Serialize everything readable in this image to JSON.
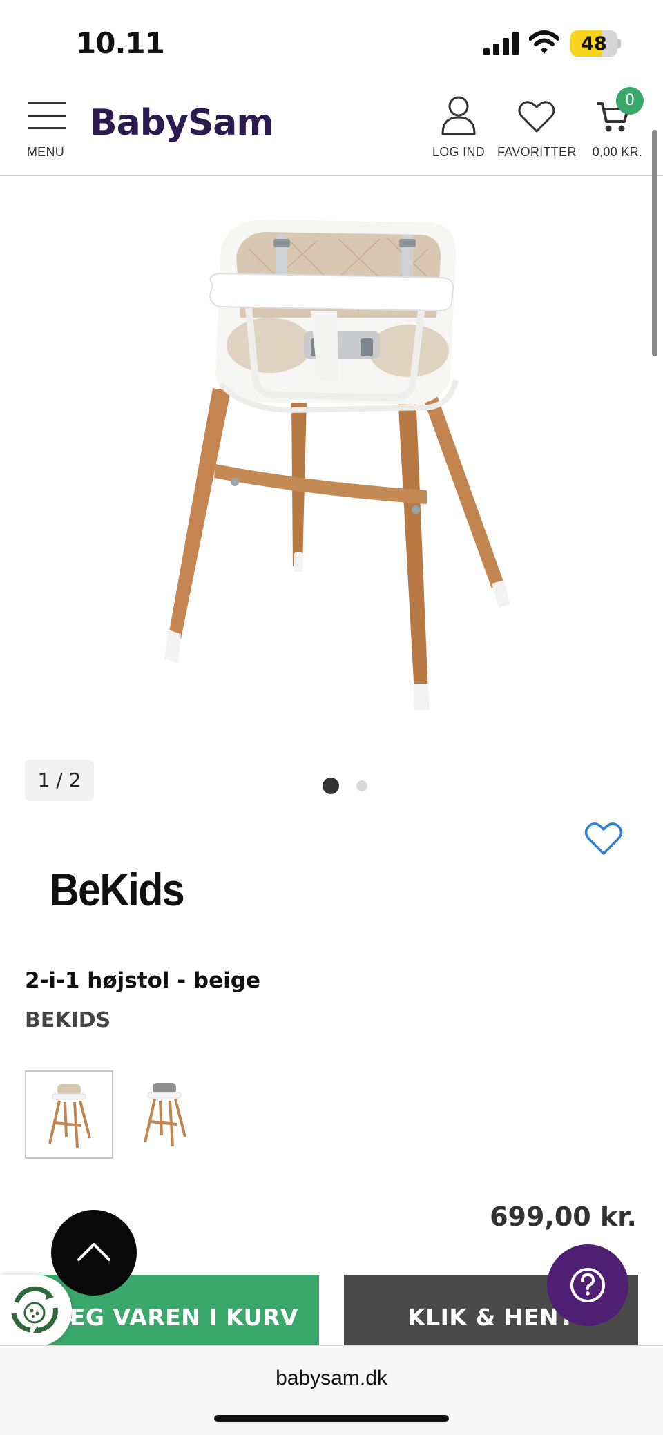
{
  "status_bar": {
    "time": "10.11",
    "battery": "48"
  },
  "header": {
    "menu_label": "MENU",
    "logo_text": "BabySam",
    "login_label": "LOG IND",
    "favorites_label": "FAVORITTER",
    "cart_label": "0,00 KR.",
    "cart_count": "0"
  },
  "gallery": {
    "counter": "1 / 2",
    "slides": 2,
    "active_slide": 1
  },
  "product": {
    "brand_logo": "BeKids",
    "title": "2-i-1 højstol - beige",
    "brand": "BEKIDS",
    "price": "699,00 kr."
  },
  "actions": {
    "add_to_cart": "LÆG VAREN I KURV",
    "click_collect": "KLIK & HENT"
  },
  "browser": {
    "url": "babysam.dk"
  },
  "colors": {
    "brand": "#2b1b4f",
    "green": "#3aa86b",
    "dark": "#4a4a4a",
    "help": "#4e1f73",
    "favorite": "#2a7fd4"
  }
}
